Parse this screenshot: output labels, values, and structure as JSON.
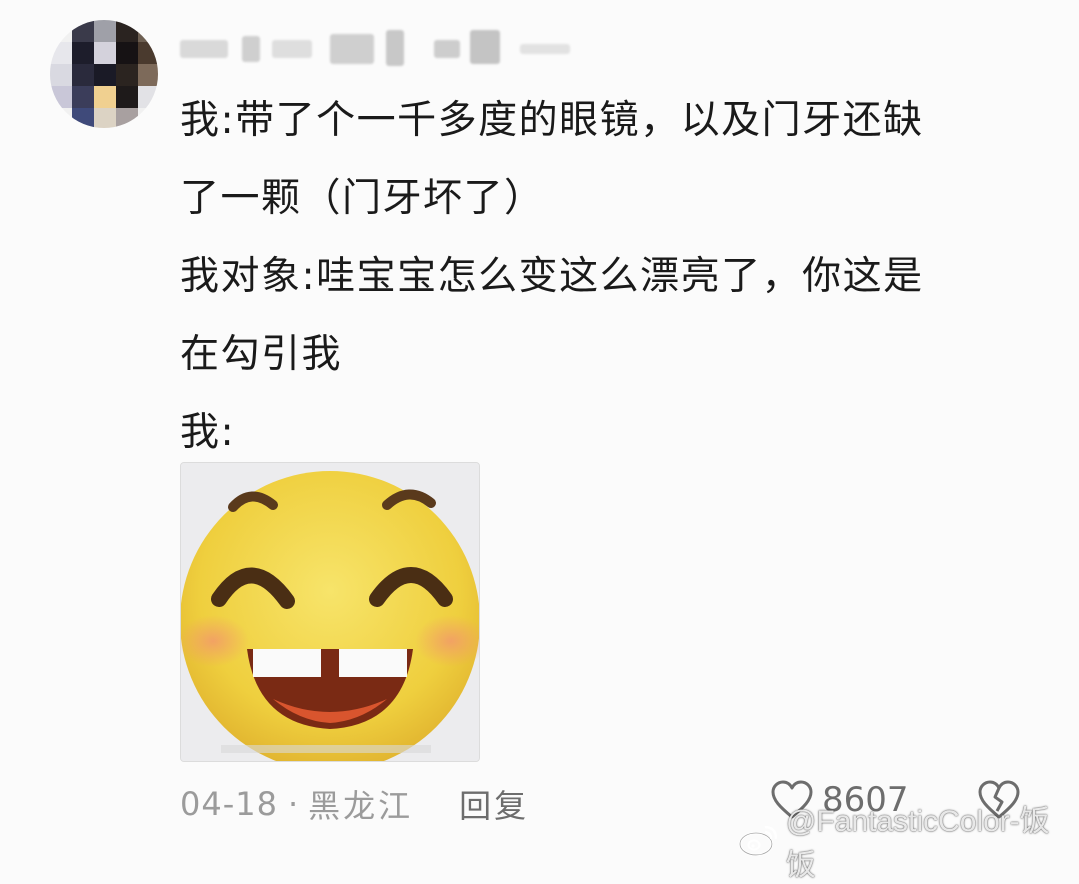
{
  "comment": {
    "username": "",
    "lines": [
      "我:带了个一千多度的眼镜，以及门牙还缺",
      "了一颗（门牙坏了）",
      "我对象:哇宝宝怎么变这么漂亮了，你这是",
      "在勾引我",
      "我:"
    ],
    "sticker": "laughing-face-missing-tooth-sticker",
    "date": "04-18",
    "separator": "·",
    "region": "黑龙江",
    "reply_label": "回复",
    "like_count": "8607"
  },
  "icons": {
    "like": "heart-outline-icon",
    "dislike": "broken-heart-icon",
    "weibo": "weibo-logo-icon"
  },
  "watermark": {
    "text": "@FantasticColor-饭饭"
  },
  "colors": {
    "background": "#fbfbfb",
    "text": "#1a1a1a",
    "meta": "#9b9b9b",
    "sticker_face": "#f2d64a"
  }
}
